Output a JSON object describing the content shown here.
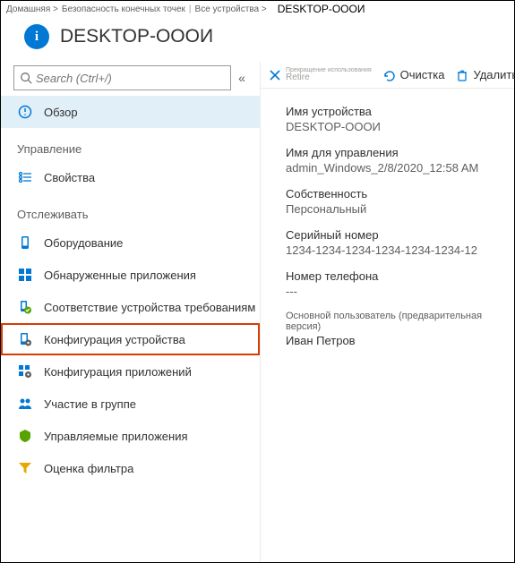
{
  "breadcrumb": {
    "home": "Домашняя >",
    "sec": "Безопасность конечных точек",
    "all": "Все устройства >",
    "current": "DESKTOP-ОООИ"
  },
  "page_title": "DESKTOP-ОООИ",
  "search": {
    "placeholder": "Search (Ctrl+/)"
  },
  "collapse_glyph": "«",
  "sidebar": {
    "overview": "Обзор",
    "section_manage": "Управление",
    "properties": "Свойства",
    "section_monitor": "Отслеживать",
    "hardware": "Оборудование",
    "discovered_apps": "Обнаруженные приложения",
    "compliance": "Соответствие устройства требованиям",
    "device_config": "Конфигурация устройства",
    "app_config": "Конфигурация приложений",
    "group_membership": "Участие в группе",
    "managed_apps": "Управляемые приложения",
    "filter_eval": "Оценка фильтра"
  },
  "actions": {
    "retire": "Прекращение использования",
    "retire_sub": "Retire",
    "wipe": "Очистка",
    "delete": "Удалить"
  },
  "details": {
    "device_name_label": "Имя устройства",
    "device_name_value": "DESKTOP-ОООИ",
    "mgmt_name_label": "Имя для управления",
    "mgmt_name_value": "admin_Windows_2/8/2020_12:58 AM",
    "ownership_label": "Собственность",
    "ownership_value": "Персональный",
    "serial_label": "Серийный номер",
    "serial_value": "1234-1234-1234-1234-1234-1234-12",
    "phone_label": "Номер телефона",
    "phone_value": "---",
    "primary_user_label": "Основной пользователь (предварительная версия)",
    "primary_user_value": "Иван Петров"
  }
}
